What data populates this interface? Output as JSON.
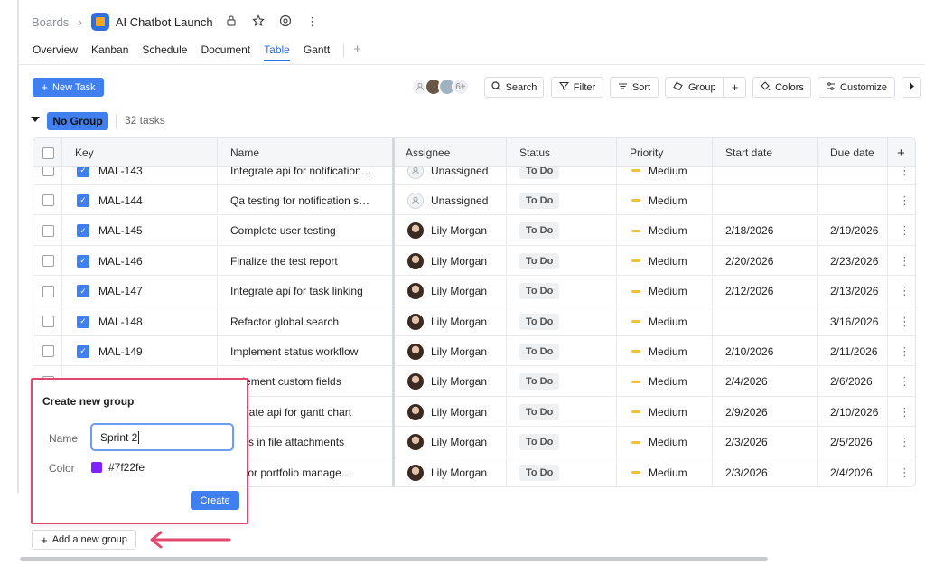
{
  "breadcrumb": {
    "root": "Boards",
    "project": "AI Chatbot Launch"
  },
  "tabs": [
    {
      "label": "Overview"
    },
    {
      "label": "Kanban"
    },
    {
      "label": "Schedule"
    },
    {
      "label": "Document"
    },
    {
      "label": "Table",
      "active": true
    },
    {
      "label": "Gantt"
    }
  ],
  "toolbar": {
    "new_task": "New Task",
    "avatar_more": "6+",
    "search": "Search",
    "filter": "Filter",
    "sort": "Sort",
    "group": "Group",
    "colors": "Colors",
    "customize": "Customize"
  },
  "group": {
    "name": "No Group",
    "count": "32 tasks",
    "color": "#3f7ff0"
  },
  "columns": [
    "Key",
    "Name",
    "Assignee",
    "Status",
    "Priority",
    "Start date",
    "Due date"
  ],
  "rows": [
    {
      "key": "MAL-143",
      "name": "Integrate api for notification…",
      "assignee": "Unassigned",
      "status": "To Do",
      "priority": "Medium",
      "start": "",
      "due": ""
    },
    {
      "key": "MAL-144",
      "name": "Qa testing for notification s…",
      "assignee": "Unassigned",
      "status": "To Do",
      "priority": "Medium",
      "start": "",
      "due": ""
    },
    {
      "key": "MAL-145",
      "name": "Complete user testing",
      "assignee": "Lily Morgan",
      "status": "To Do",
      "priority": "Medium",
      "start": "2/18/2026",
      "due": "2/19/2026"
    },
    {
      "key": "MAL-146",
      "name": "Finalize the test report",
      "assignee": "Lily Morgan",
      "status": "To Do",
      "priority": "Medium",
      "start": "2/20/2026",
      "due": "2/23/2026"
    },
    {
      "key": "MAL-147",
      "name": "Integrate api for task linking",
      "assignee": "Lily Morgan",
      "status": "To Do",
      "priority": "Medium",
      "start": "2/12/2026",
      "due": "2/13/2026"
    },
    {
      "key": "MAL-148",
      "name": "Refactor global search",
      "assignee": "Lily Morgan",
      "status": "To Do",
      "priority": "Medium",
      "start": "",
      "due": "3/16/2026"
    },
    {
      "key": "MAL-149",
      "name": "Implement status workflow",
      "assignee": "Lily Morgan",
      "status": "To Do",
      "priority": "Medium",
      "start": "2/10/2026",
      "due": "2/11/2026"
    },
    {
      "key": "",
      "name": "nplement custom fields",
      "assignee": "Lily Morgan",
      "status": "To Do",
      "priority": "Medium",
      "start": "2/4/2026",
      "due": "2/6/2026"
    },
    {
      "key": "",
      "name": "tegrate api for gantt chart",
      "assignee": "Lily Morgan",
      "status": "To Do",
      "priority": "Medium",
      "start": "2/9/2026",
      "due": "2/10/2026"
    },
    {
      "key": "",
      "name": "bugs in file attachments",
      "assignee": "Lily Morgan",
      "status": "To Do",
      "priority": "Medium",
      "start": "2/3/2026",
      "due": "2/5/2026"
    },
    {
      "key": "",
      "name": "factor portfolio manage…",
      "assignee": "Lily Morgan",
      "status": "To Do",
      "priority": "Medium",
      "start": "2/3/2026",
      "due": "2/4/2026"
    }
  ],
  "popup": {
    "title": "Create new group",
    "name_label": "Name",
    "name_value": "Sprint 2",
    "color_label": "Color",
    "color_value": "#7f22fe",
    "create": "Create"
  },
  "add_group": "Add a new group"
}
